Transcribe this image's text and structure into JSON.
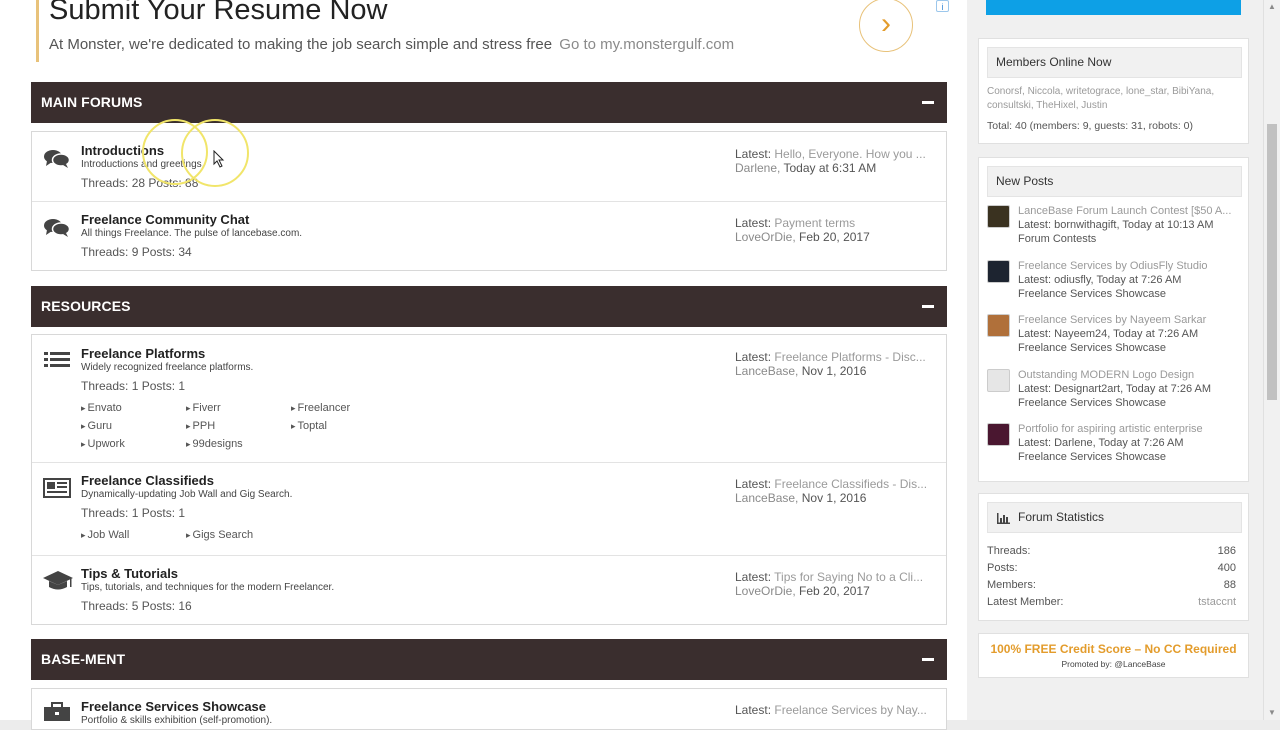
{
  "ad": {
    "title": "Submit Your Resume Now",
    "text": "At Monster, we're dedicated to making the job search simple and stress free",
    "link": "Go to my.monstergulf.com",
    "arrow": "›",
    "info": "i"
  },
  "categories": [
    {
      "title": "MAIN FORUMS",
      "toggle": "collapse"
    },
    {
      "title": "RESOURCES",
      "toggle": "collapse"
    },
    {
      "title": "BASE-MENT",
      "toggle": "collapse"
    }
  ],
  "forums": {
    "introductions": {
      "icon": "chat-bubbles-icon",
      "title": "Introductions",
      "desc": "Introductions and greetings.",
      "stats": "Threads: 28   Posts: 88",
      "latest_label": "Latest:",
      "latest_title": "Hello, Everyone. How you ...",
      "latest_by": "Darlene,",
      "latest_time": "Today at 6:31 AM"
    },
    "community": {
      "icon": "chat-bubbles-icon",
      "title": "Freelance Community Chat",
      "desc": "All things Freelance. The pulse of lancebase.com.",
      "stats": "Threads: 9   Posts: 34",
      "latest_label": "Latest:",
      "latest_title": "Payment terms",
      "latest_by": "LoveOrDie,",
      "latest_time": "Feb 20, 2017"
    },
    "platforms": {
      "icon": "list-icon",
      "title": "Freelance Platforms",
      "desc": "Widely recognized freelance platforms.",
      "stats": "Threads: 1   Posts: 1",
      "latest_label": "Latest:",
      "latest_title": "Freelance Platforms - Disc...",
      "latest_by": "LanceBase,",
      "latest_time": "Nov 1, 2016",
      "subforums": [
        "Envato",
        "Fiverr",
        "Freelancer",
        "Guru",
        "PPH",
        "Toptal",
        "Upwork",
        "99designs"
      ]
    },
    "classifieds": {
      "icon": "newspaper-icon",
      "title": "Freelance Classifieds",
      "desc": "Dynamically-updating Job Wall and Gig Search.",
      "stats": "Threads: 1   Posts: 1",
      "latest_label": "Latest:",
      "latest_title": "Freelance Classifieds - Dis...",
      "latest_by": "LanceBase,",
      "latest_time": "Nov 1, 2016",
      "subforums": [
        "Job Wall",
        "Gigs Search"
      ]
    },
    "tips": {
      "icon": "graduation-cap-icon",
      "title": "Tips & Tutorials",
      "desc": "Tips, tutorials, and techniques for the modern Freelancer.",
      "stats": "Threads: 5   Posts: 16",
      "latest_label": "Latest:",
      "latest_title": "Tips for Saying No to a Cli...",
      "latest_by": "LoveOrDie,",
      "latest_time": "Feb 20, 2017"
    },
    "showcase": {
      "icon": "briefcase-icon",
      "title": "Freelance Services Showcase",
      "desc": "Portfolio & skills exhibition (self-promotion).",
      "latest_label": "Latest:",
      "latest_title": "Freelance Services by Nay..."
    }
  },
  "sidebar": {
    "members_online": {
      "title": "Members Online Now",
      "names": "Conorsf, Niccola, writetograce, lone_star, BibiYana, consultski, TheHixel, Justin",
      "total": "Total: 40 (members: 9, guests: 31, robots: 0)"
    },
    "new_posts": {
      "title": "New Posts",
      "items": [
        {
          "title": "LanceBase Forum Launch Contest [$50 A...",
          "latest": "Latest: bornwithagift, Today at 10:13 AM",
          "forum": "Forum Contests",
          "avatar_color": "#3a3220"
        },
        {
          "title": "Freelance Services by OdiusFly Studio",
          "latest": "Latest: odiusfly, Today at 7:26 AM",
          "forum": "Freelance Services Showcase",
          "avatar_color": "#1d2430"
        },
        {
          "title": "Freelance Services by Nayeem Sarkar",
          "latest": "Latest: Nayeem24, Today at 7:26 AM",
          "forum": "Freelance Services Showcase",
          "avatar_color": "#b0703a"
        },
        {
          "title": "Outstanding MODERN Logo Design",
          "latest": "Latest: Designart2art, Today at 7:26 AM",
          "forum": "Freelance Services Showcase",
          "avatar_color": "#e6e6e6"
        },
        {
          "title": "Portfolio for aspiring artistic enterprise",
          "latest": "Latest: Darlene, Today at 7:26 AM",
          "forum": "Freelance Services Showcase",
          "avatar_color": "#4a1730"
        }
      ]
    },
    "stats": {
      "title": "Forum Statistics",
      "rows": [
        {
          "label": "Threads:",
          "value": "186"
        },
        {
          "label": "Posts:",
          "value": "400"
        },
        {
          "label": "Members:",
          "value": "88"
        },
        {
          "label": "Latest Member:",
          "value": "tstaccnt"
        }
      ]
    },
    "promo": {
      "text": "100% FREE Credit Score – No CC Required",
      "by": "Promoted by: @LanceBase"
    }
  }
}
